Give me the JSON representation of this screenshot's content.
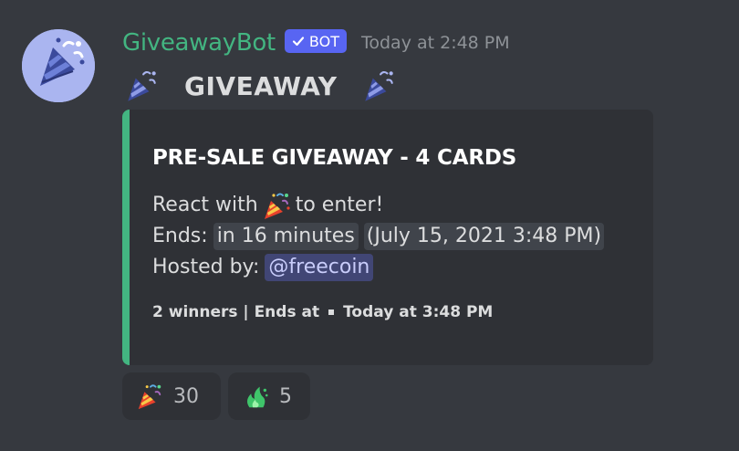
{
  "author": {
    "name": "GiveawayBot",
    "bot_tag": "BOT",
    "timestamp": "Today at 2:48 PM",
    "avatar_icon": "party-popper-icon"
  },
  "message": {
    "title": "GIVEAWAY",
    "emoji": "party-popper-icon"
  },
  "embed": {
    "accent_color": "#43b581",
    "heading": "PRE-SALE GIVEAWAY - 4 CARDS",
    "react_prefix": "React with",
    "react_suffix": "to enter!",
    "ends_label": "Ends:",
    "ends_relative": "in 16 minutes",
    "ends_absolute": "July 15, 2021 3:48 PM",
    "hosted_label": "Hosted by:",
    "host_mention": "@freecoin",
    "footer_left": "2 winners | Ends at",
    "footer_right": "Today at 3:48 PM"
  },
  "reactions": [
    {
      "emoji": "party-popper-icon",
      "count": "30"
    },
    {
      "emoji": "green-flame-icon",
      "count": "5"
    }
  ],
  "colors": {
    "background": "#36393f",
    "embed_bg": "#2f3136",
    "username": "#43b581",
    "bot_tag": "#5865f2",
    "mention_bg": "#414675"
  }
}
